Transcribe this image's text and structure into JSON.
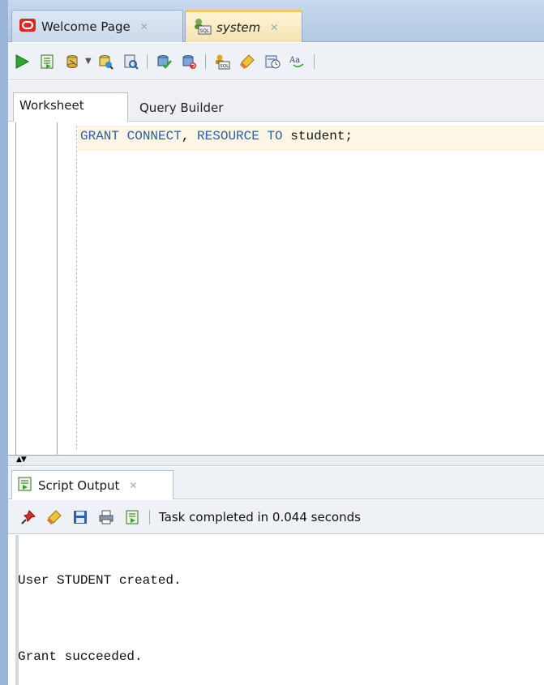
{
  "tabs": [
    {
      "label": "Welcome Page",
      "icon": "oracle-logo-icon",
      "active": false
    },
    {
      "label": "system",
      "icon": "sql-connection-icon",
      "active": true
    }
  ],
  "toolbar": {
    "icons": [
      "run-statement-icon",
      "run-script-icon",
      "autotrace-icon",
      "explain-plan-icon",
      "sql-tuning-icon",
      "commit-icon",
      "rollback-icon",
      "unshared-sql-icon",
      "clear-icon",
      "sql-history-icon",
      "to-upper-lower-icon"
    ]
  },
  "worksheet_tabs": {
    "worksheet": "Worksheet",
    "query_builder": "Query Builder"
  },
  "editor": {
    "sql_tokens": [
      "GRANT CONNECT",
      ", ",
      "RESOURCE TO",
      " student;"
    ]
  },
  "output": {
    "tab_label": "Script Output",
    "status": "Task completed in 0.044 seconds",
    "lines": [
      "User STUDENT created.",
      "Grant succeeded."
    ]
  },
  "colors": {
    "keyword": "#2a5fa8",
    "active_tab_accent": "#f0c85a",
    "window_edge": "#9ab5d8"
  }
}
